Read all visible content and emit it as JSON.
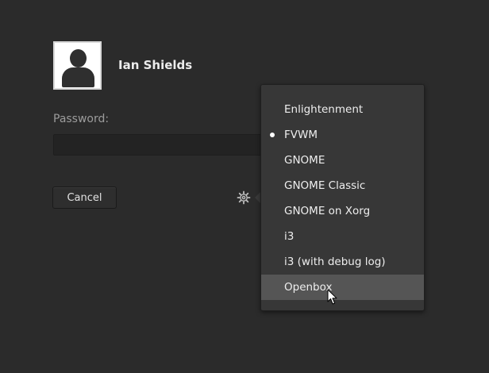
{
  "user": {
    "name": "Ian Shields",
    "avatar_icon": "user-avatar-icon"
  },
  "login": {
    "password_label": "Password:",
    "password_value": "",
    "cancel_label": "Cancel",
    "settings_icon": "gear-icon"
  },
  "session_menu": {
    "items": [
      {
        "label": "Enlightenment",
        "selected": false
      },
      {
        "label": "FVWM",
        "selected": true
      },
      {
        "label": "GNOME",
        "selected": false
      },
      {
        "label": "GNOME Classic",
        "selected": false
      },
      {
        "label": "GNOME on Xorg",
        "selected": false
      },
      {
        "label": "i3",
        "selected": false
      },
      {
        "label": "i3 (with debug log)",
        "selected": false
      },
      {
        "label": "Openbox",
        "selected": false,
        "hovered": true
      }
    ]
  },
  "colors": {
    "background": "#2b2b2b",
    "menu_background": "#373737",
    "menu_hover": "#555555"
  }
}
